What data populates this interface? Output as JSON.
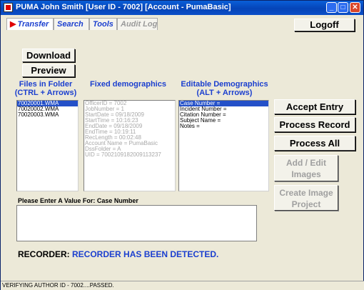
{
  "window": {
    "title": "PUMA   John Smith [User ID - 7002] [Account - PumaBasic]",
    "minimize": "_",
    "maximize": "□",
    "close": "✕"
  },
  "tabs": [
    {
      "label": "Transfer",
      "arrow": "▶"
    },
    {
      "label": "Search"
    },
    {
      "label": "Tools"
    },
    {
      "label": "Audit Log"
    }
  ],
  "buttons": {
    "logoff": "Logoff",
    "download": "Download",
    "preview": "Preview",
    "accept_entry": "Accept Entry",
    "process_record": "Process Record",
    "process_all": "Process All",
    "add_edit_images_1": "Add / Edit",
    "add_edit_images_2": "Images",
    "create_image_project_1": "Create Image",
    "create_image_project_2": "Project"
  },
  "labels": {
    "files_in_folder_1": "Files in Folder",
    "files_in_folder_2": "(CTRL + Arrows)",
    "fixed_demographics": "Fixed demographics",
    "editable_demographics_1": "Editable Demographics",
    "editable_demographics_2": "(ALT + Arrows)"
  },
  "files": [
    "70020001.WMA",
    "70020002.WMA",
    "70020003.WMA"
  ],
  "fixed_demographics": [
    "OfficerID = 7002",
    "JobNumber = 1",
    "StartDate = 09/18/2009",
    "StartTime = 10:16:23",
    "EndDate = 09/18/2009",
    "EndTime = 10:19:11",
    "RecLength = 00:02:48",
    "Account Name = PumaBasic",
    "DssFolder = A",
    "UID = 7002109182009113237"
  ],
  "editable_demographics": [
    "Case Number =",
    "Incident Number =",
    "Citation Number =",
    "Subject Name =",
    "Notes ="
  ],
  "prompt": "Please Enter A Value For: Case Number",
  "input": {
    "value": ""
  },
  "recorder": {
    "label": "RECORDER:",
    "value": "RECORDER HAS BEEN DETECTED."
  },
  "status": "VERIFYING AUTHOR ID - 7002....PASSED.",
  "colors": {
    "accent": "#1b3fcf",
    "selection": "#2450c8",
    "title_bar": "#0544b8"
  }
}
